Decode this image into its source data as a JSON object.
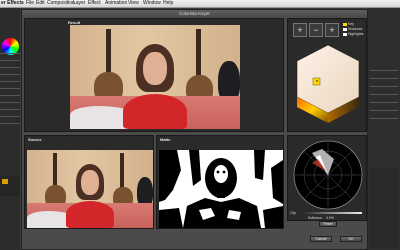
{
  "menubar": {
    "app_name": "er Effects",
    "items": [
      "File",
      "Edit",
      "Composition",
      "Layer",
      "Effect",
      "Animation",
      "View",
      "Window",
      "Help"
    ]
  },
  "dialog": {
    "title": "Colorista Keyer",
    "panels": {
      "result": "Result",
      "source": "Source",
      "matte": "Matte"
    },
    "legend": [
      {
        "label": "Key",
        "color": "#ffd800"
      },
      {
        "label": "Shadows",
        "color": "#ffffff"
      },
      {
        "label": "Highlights",
        "color": "#ffffff"
      }
    ],
    "controls": {
      "softness_label": "Softness:",
      "softness_value": "0.0%",
      "reset_label": "Reset",
      "clip_label": "Clip",
      "cancel_label": "Cancel",
      "ok_label": "OK"
    }
  },
  "colors": {
    "accent": "#ffd800",
    "dialog_bg": "#4b4b4b",
    "panel_bg": "#2a2a2a"
  },
  "icons": {
    "add_color": "plus-icon",
    "subtract_color": "minus-icon",
    "add_color_alt": "plus-icon"
  }
}
